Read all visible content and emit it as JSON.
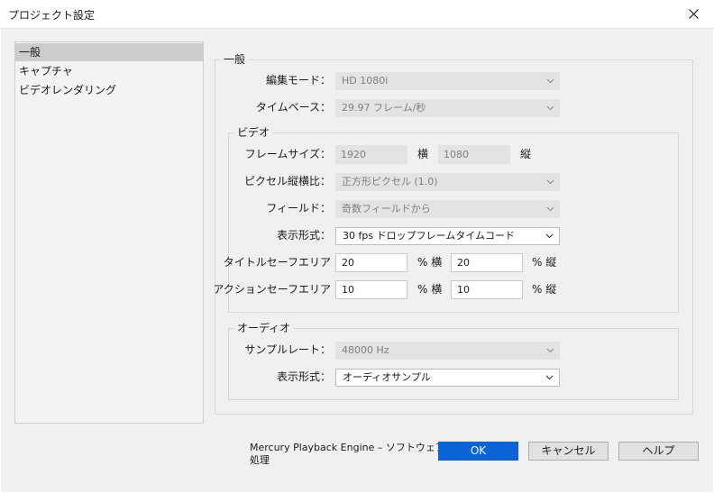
{
  "window": {
    "title": "プロジェクト設定"
  },
  "sidebar": {
    "items": [
      "一般",
      "キャプチャ",
      "ビデオレンダリング"
    ]
  },
  "general": {
    "label": "一般",
    "edit_mode": {
      "label": "編集モード：",
      "value": "HD 1080i"
    },
    "timebase": {
      "label": "タイムベース：",
      "value": "29.97 フレーム/秒"
    }
  },
  "video": {
    "label": "ビデオ",
    "frame_size": {
      "label": "フレームサイズ：",
      "width": "1920",
      "width_unit": "横",
      "height": "1080",
      "height_unit": "縦"
    },
    "pixel_aspect": {
      "label": "ピクセル縦横比：",
      "value": "正方形ピクセル (1.0)"
    },
    "fields": {
      "label": "フィールド：",
      "value": "奇数フィールドから"
    },
    "display_format": {
      "label": "表示形式：",
      "value": "30 fps ドロップフレームタイムコード"
    },
    "title_safe": {
      "label": "タイトルセーフエリア",
      "h": "20",
      "h_unit": "% 横",
      "v": "20",
      "v_unit": "% 縦"
    },
    "action_safe": {
      "label": "アクションセーフエリア",
      "h": "10",
      "h_unit": "% 横",
      "v": "10",
      "v_unit": "% 縦"
    }
  },
  "audio": {
    "label": "オーディオ",
    "sample_rate": {
      "label": "サンプルレート：",
      "value": "48000 Hz"
    },
    "display_format": {
      "label": "表示形式：",
      "value": "オーディオサンプル"
    }
  },
  "footer": {
    "renderer_line1": "Mercury Playback Engine – ソフトウェア",
    "renderer_line2": "処理",
    "ok": "OK",
    "cancel": "キャンセル",
    "help": "ヘルプ"
  },
  "colors": {
    "accent": "#0a64d7",
    "selection": "#cccccc",
    "disabled_field": "#e3e3e3"
  }
}
